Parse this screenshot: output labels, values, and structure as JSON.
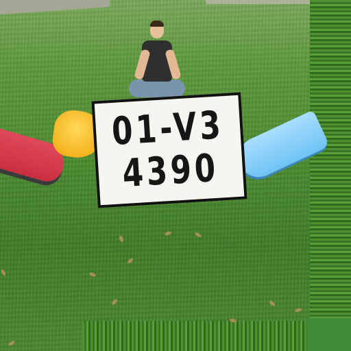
{
  "scene": {
    "description_label": "",
    "plate": {
      "line1": "01-V3",
      "line2": "4390"
    }
  }
}
